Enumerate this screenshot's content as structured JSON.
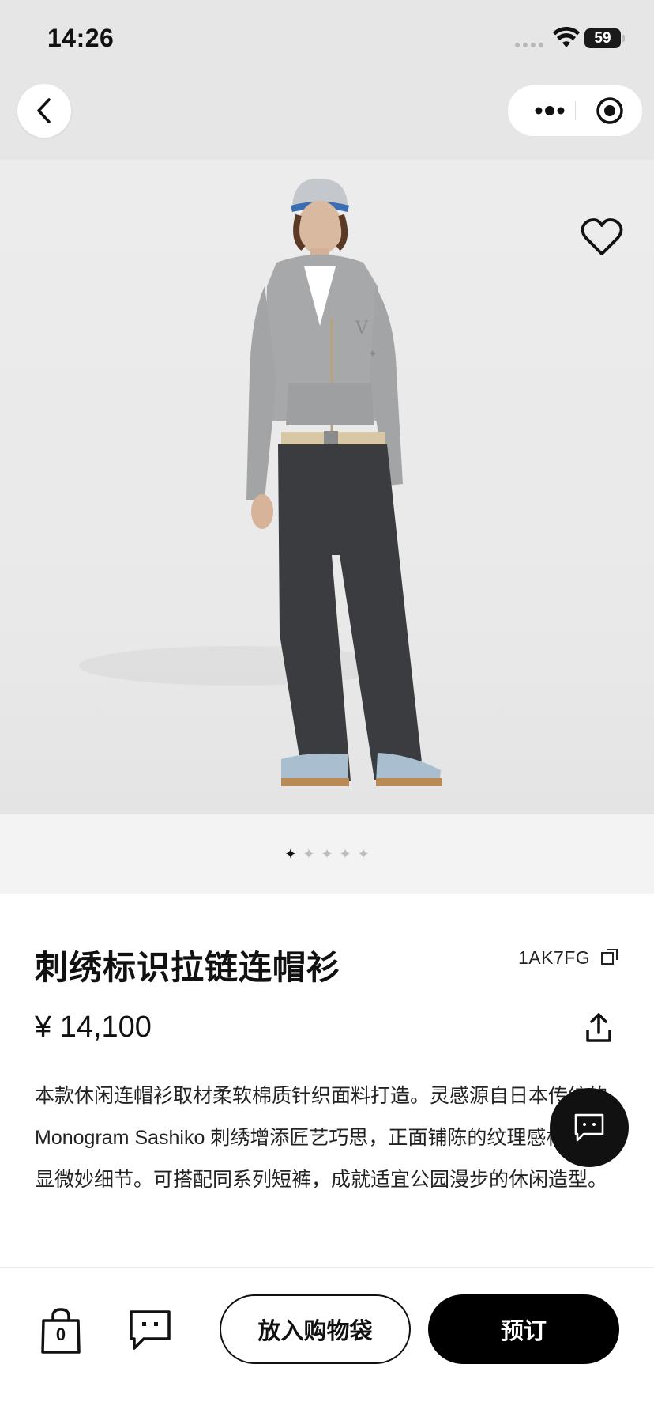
{
  "status_bar": {
    "time": "14:26",
    "battery": "59"
  },
  "nav": {
    "back_icon": "chevron-left-icon",
    "more_icon": "more-dots-icon",
    "close_icon": "target-circle-icon"
  },
  "hero": {
    "favorite_icon": "heart-outline-icon",
    "pager": {
      "total": 5,
      "active_index": 0
    }
  },
  "product": {
    "title": "刺绣标识拉链连帽衫",
    "sku": "1AK7FG",
    "price": "¥ 14,100",
    "description_lines": [
      "本款休闲连帽衫取材柔软棉质针织面料打造。灵感源自日本传统的",
      "Monogram Sashiko 刺绣增添匠艺巧思，正面铺陈的纹理感标识",
      "显微妙细节。可搭配同系列短裤，成就适宜公园漫步的休闲造型。"
    ]
  },
  "bottom_bar": {
    "bag_count": "0",
    "add_to_bag_label": "放入购物袋",
    "reserve_label": "预订"
  },
  "colors": {
    "header_bg": "#e6e6e6",
    "primary": "#000000",
    "pager_bg": "#f3f3f3"
  }
}
